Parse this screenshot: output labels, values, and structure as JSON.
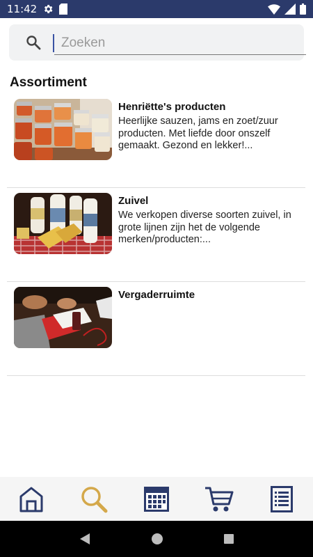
{
  "status_bar": {
    "time": "11:42",
    "icons": [
      "gear-icon",
      "sd-card-icon",
      "wifi-icon",
      "signal-icon",
      "battery-icon"
    ]
  },
  "search": {
    "placeholder": "Zoeken",
    "value": ""
  },
  "section": {
    "title": "Assortiment"
  },
  "items": [
    {
      "title": "Henriëtte's producten",
      "description": "Heerlijke sauzen, jams en zoet/zuur producten. Met liefde door onszelf gemaakt. Gezond en lekker!..."
    },
    {
      "title": "Zuivel",
      "description": "We verkopen diverse soorten zuivel, in grote lijnen zijn het de volgende merken/producten:..."
    },
    {
      "title": "Vergaderruimte",
      "description": ""
    }
  ],
  "tabs": [
    {
      "icon": "home-icon",
      "active": false
    },
    {
      "icon": "search-icon",
      "active": true
    },
    {
      "icon": "calendar-icon",
      "active": false
    },
    {
      "icon": "cart-icon",
      "active": false
    },
    {
      "icon": "list-icon",
      "active": false
    }
  ],
  "colors": {
    "status_bar": "#2b3a6b",
    "tab_icon": "#2b3a6b",
    "tab_active": "#d4a84a",
    "search_bg": "#f1f2f3"
  },
  "nav_bar": {
    "icons": [
      "back-icon",
      "home-circle-icon",
      "recents-icon"
    ]
  }
}
